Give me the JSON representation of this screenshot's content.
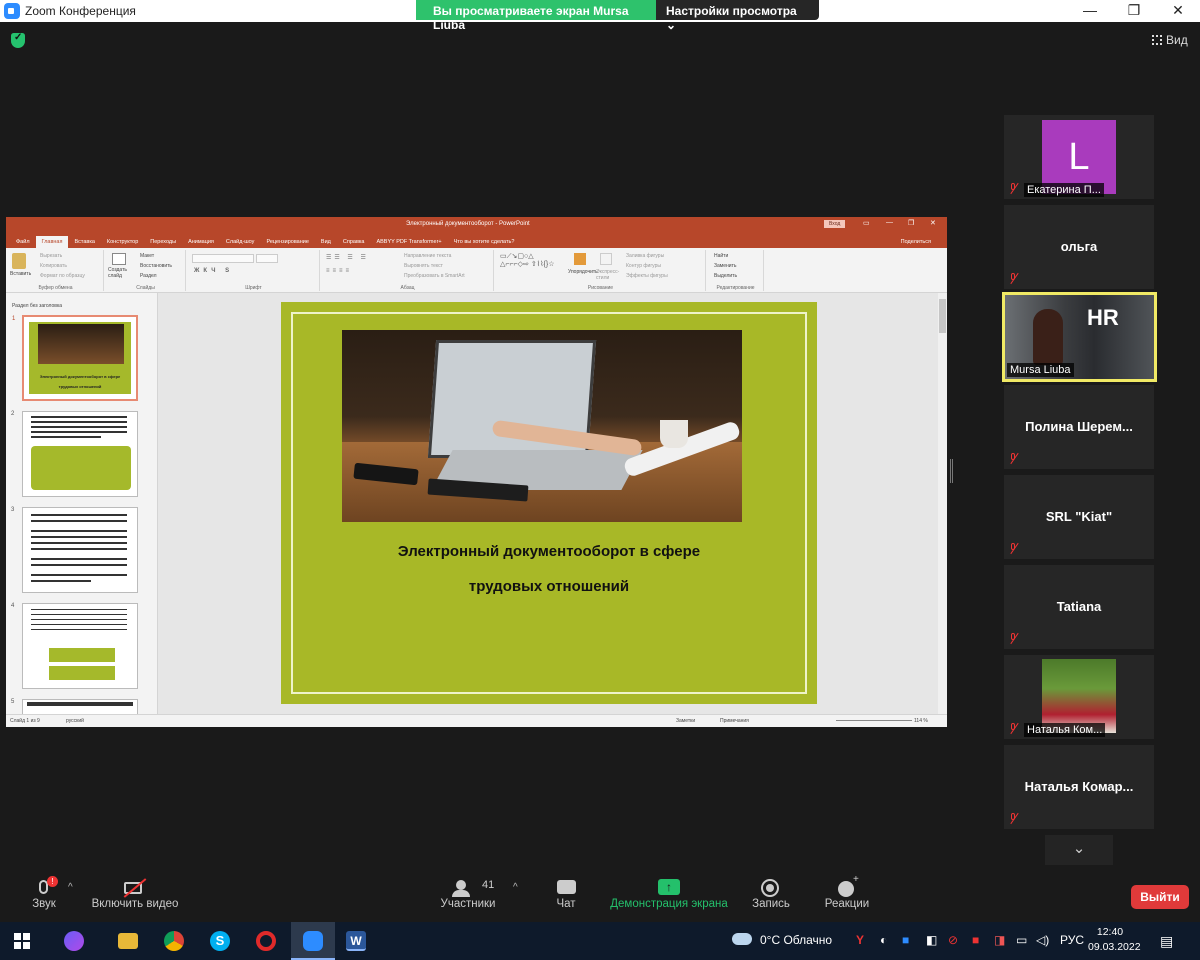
{
  "window": {
    "title": "Zoom Конференция",
    "minimize": "—",
    "maximize": "❐",
    "close": "✕"
  },
  "share_banner": {
    "viewing": "Вы просматриваете экран Mursa Liuba",
    "view_options": "Настройки просмотра ⌄"
  },
  "view_button": "Вид",
  "ppt": {
    "title": "Электронный документооборот - PowerPoint",
    "sign_in": "Вход",
    "tabs": [
      "Файл",
      "Главная",
      "Вставка",
      "Конструктор",
      "Переходы",
      "Анимация",
      "Слайд-шоу",
      "Рецензирование",
      "Вид",
      "Справка",
      "ABBYY PDF Transformer+",
      "Что вы хотите сделать?"
    ],
    "share": "Поделиться",
    "ribbon": {
      "paste": "Вставить",
      "cut": "Вырезать",
      "copy": "Копировать",
      "format_painter": "Формат по образцу",
      "clipboard": "Буфер обмена",
      "new_slide": "Создать слайд",
      "layout": "Макет",
      "reset": "Восстановить",
      "section": "Раздел",
      "slides": "Слайды",
      "font": "Шрифт",
      "text_direction": "Направление текста",
      "align_text": "Выровнять текст",
      "smartart": "Преобразовать в SmartArt",
      "paragraph": "Абзац",
      "arrange": "Упорядочить",
      "quick_styles": "Экспресс-стили",
      "shape_fill": "Заливка фигуры",
      "shape_outline": "Контур фигуры",
      "shape_effects": "Эффекты фигуры",
      "drawing": "Рисование",
      "find": "Найти",
      "replace": "Заменить",
      "select": "Выделить",
      "editing": "Редактирование"
    },
    "section_label": "Раздел без заголовка",
    "thumbs": [
      "1",
      "2",
      "3",
      "4",
      "5"
    ],
    "thumb1_title": "Электронный документооборот в сфере трудовых отношений",
    "slide_title_1": "Электронный документооборот в сфере",
    "slide_title_2": "трудовых отношений",
    "status": {
      "slide_count": "Слайд 1 из 9",
      "language": "русский",
      "notes": "Заметки",
      "comments": "Примечания",
      "zoom": "114 %"
    }
  },
  "participants": [
    {
      "name": "Екатерина П...",
      "avatar_letter": "L",
      "avatar_color": "#a93bbd"
    },
    {
      "name": "ольга"
    },
    {
      "name": "Mursa Liuba",
      "active": true
    },
    {
      "name": "Полина  Шерем..."
    },
    {
      "name": "SRL \"Kiat\""
    },
    {
      "name": "Tatiana"
    },
    {
      "name": "Наталья Ком..."
    },
    {
      "name": "Наталья  Комар..."
    }
  ],
  "toolbar": {
    "audio": "Звук",
    "video": "Включить видео",
    "participants": "Участники",
    "participants_count": "41",
    "chat": "Чат",
    "share_screen": "Демонстрация экрана",
    "record": "Запись",
    "reactions": "Реакции",
    "leave": "Выйти"
  },
  "taskbar": {
    "weather": "0°C  Облачно",
    "language": "РУС",
    "time": "12:40",
    "date": "09.03.2022"
  },
  "colors": {
    "zoom_green": "#24c06b",
    "leave_red": "#e03a3a",
    "ppt_red": "#b7472a",
    "slide_green": "#a8b827",
    "active_speaker": "#f1ea65"
  }
}
